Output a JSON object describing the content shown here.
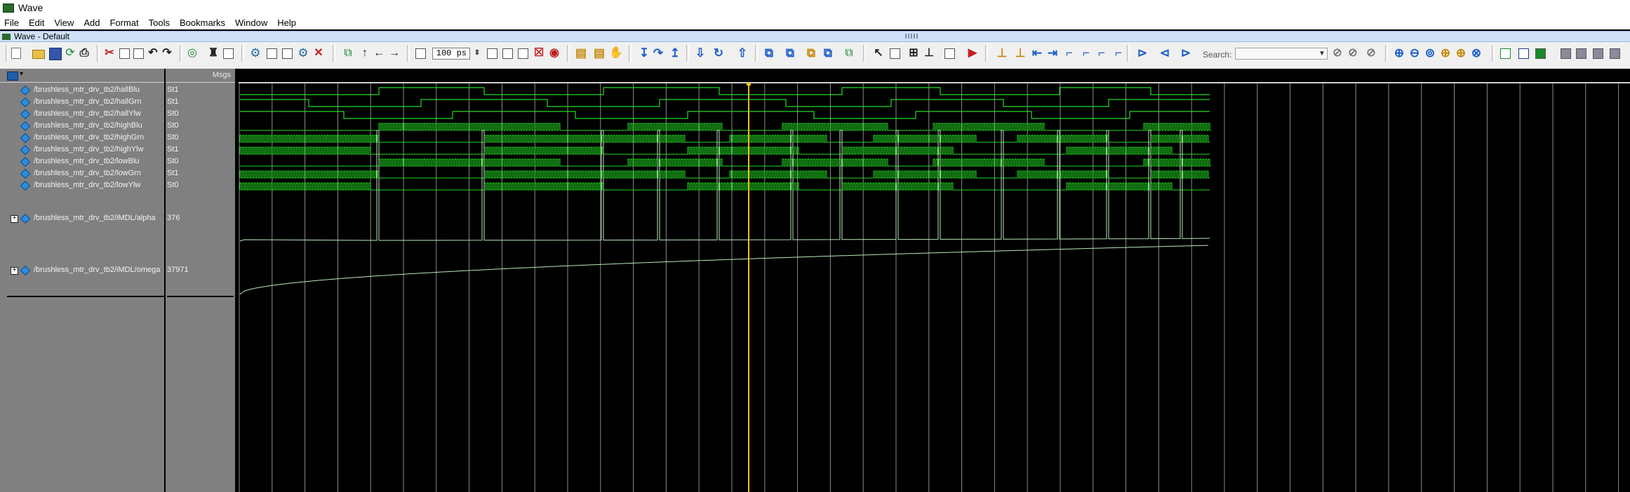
{
  "window": {
    "title": "Wave"
  },
  "menubar": {
    "items": [
      "File",
      "Edit",
      "View",
      "Add",
      "Format",
      "Tools",
      "Bookmarks",
      "Window",
      "Help"
    ]
  },
  "pane": {
    "title": "Wave - Default"
  },
  "toolbar": {
    "zoom_value": "100 ps",
    "search_label": "Search:",
    "search_value": ""
  },
  "waveform": {
    "value_header": "Msgs",
    "signals": [
      {
        "name": "/brushless_mtr_drv_tb2/hallBlu",
        "value": "St1",
        "expandable": false
      },
      {
        "name": "/brushless_mtr_drv_tb2/hallGrn",
        "value": "St1",
        "expandable": false
      },
      {
        "name": "/brushless_mtr_drv_tb2/hallYlw",
        "value": "St0",
        "expandable": false
      },
      {
        "name": "/brushless_mtr_drv_tb2/highBlu",
        "value": "St0",
        "expandable": false
      },
      {
        "name": "/brushless_mtr_drv_tb2/highGrn",
        "value": "St0",
        "expandable": false
      },
      {
        "name": "/brushless_mtr_drv_tb2/highYlw",
        "value": "St1",
        "expandable": false
      },
      {
        "name": "/brushless_mtr_drv_tb2/lowBlu",
        "value": "St0",
        "expandable": false
      },
      {
        "name": "/brushless_mtr_drv_tb2/lowGrn",
        "value": "St1",
        "expandable": false
      },
      {
        "name": "/brushless_mtr_drv_tb2/lowYlw",
        "value": "St0",
        "expandable": false
      },
      {
        "name": "/brushless_mtr_drv_tb2/iMDL/alpha",
        "value": "376",
        "expandable": true
      },
      {
        "name": "/brushless_mtr_drv_tb2/iMDL/omega",
        "value": "37971",
        "expandable": true
      }
    ],
    "colors": {
      "background": "#000000",
      "signal": "#22dd22",
      "analog": "#bde8bd",
      "cursor": "#f0c020",
      "grid": "#8a8a8a",
      "names_panel": "#808080"
    }
  }
}
